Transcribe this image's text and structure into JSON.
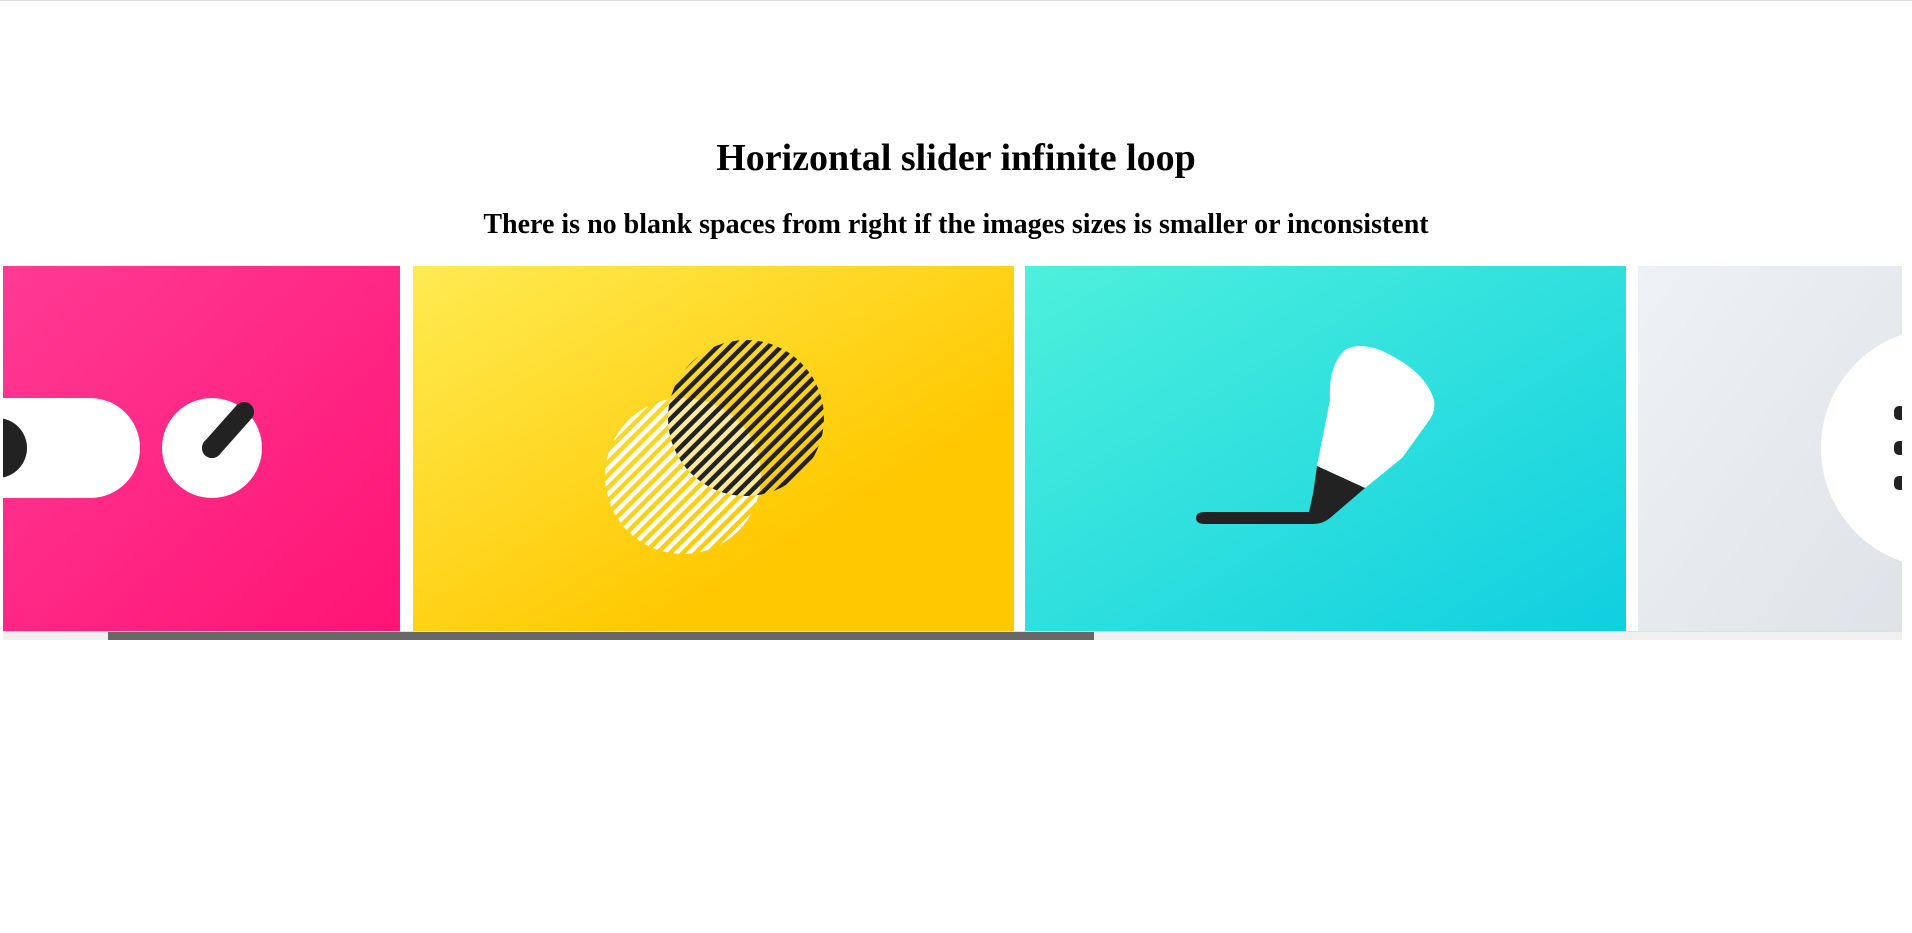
{
  "page": {
    "title": "Horizontal slider infinite loop",
    "subtitle": "There is no blank spaces from right if the images sizes is smaller or inconsistent"
  },
  "slider": {
    "slides": [
      {
        "name": "pink-toggle-knob-slide",
        "colors": {
          "from": "#ff3a95",
          "to": "#ff1474"
        },
        "icons": [
          "toggle-switch-icon",
          "knob-dial-icon"
        ]
      },
      {
        "name": "yellow-venn-circles-slide",
        "colors": {
          "from": "#ffeb52",
          "to": "#ffc800"
        },
        "icons": [
          "hatched-circles-icon"
        ]
      },
      {
        "name": "teal-brush-slide",
        "colors": {
          "from": "#4df0dc",
          "to": "#10cfe0"
        },
        "icons": [
          "paint-brush-icon"
        ]
      },
      {
        "name": "grey-partial-slide",
        "colors": {
          "from": "#eef1f5",
          "to": "#dfe3e8"
        },
        "icons": [
          "circle-dots-icon"
        ]
      }
    ],
    "scroll_position": 0.08
  },
  "colors": {
    "ink": "#222222",
    "white": "#ffffff",
    "scroll_thumb": "#686868",
    "scroll_track": "#f0f0f0"
  }
}
